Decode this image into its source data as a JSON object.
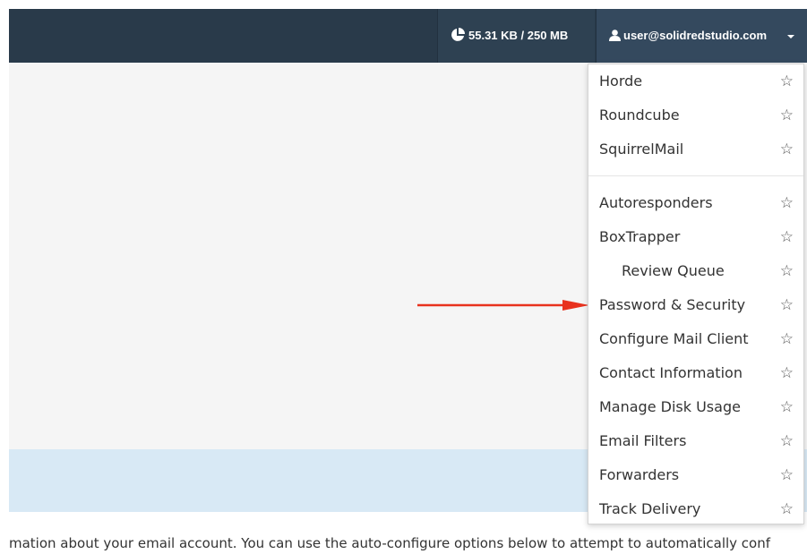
{
  "header": {
    "disk_usage": "55.31 KB / 250 MB",
    "disk_icon": "pie-chart-icon",
    "user_email": "user@solidredstudio.com",
    "user_icon": "user-icon",
    "caret_icon": "caret-down-icon"
  },
  "menu": {
    "webmail_items": [
      {
        "label": "Horde"
      },
      {
        "label": "Roundcube"
      },
      {
        "label": "SquirrelMail"
      }
    ],
    "account_items": [
      {
        "label": "Autoresponders"
      },
      {
        "label": "BoxTrapper"
      },
      {
        "label": "Review Queue"
      },
      {
        "label": "Password & Security"
      },
      {
        "label": "Configure Mail Client"
      },
      {
        "label": "Contact Information"
      },
      {
        "label": "Manage Disk Usage"
      },
      {
        "label": "Email Filters"
      },
      {
        "label": "Forwarders"
      },
      {
        "label": "Track Delivery"
      }
    ],
    "star_glyph": "☆"
  },
  "content": {
    "bottom_text": "mation about your email account. You can use the auto-configure options below to attempt to automatically conf"
  },
  "colors": {
    "topbar": "#293a4a",
    "arrow": "#e8321e",
    "info_band": "#d8e9f5"
  }
}
